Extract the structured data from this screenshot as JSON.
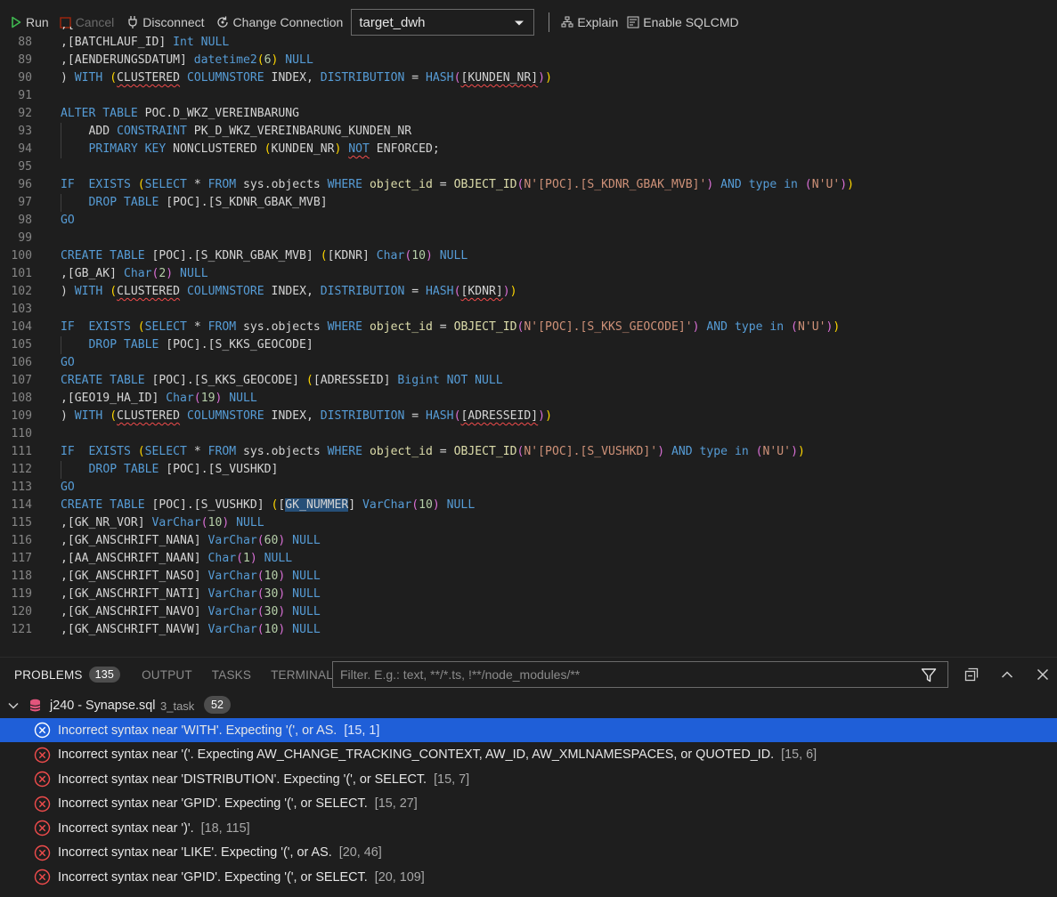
{
  "toolbar": {
    "run": "Run",
    "cancel": "Cancel",
    "disconnect": "Disconnect",
    "change_connection": "Change Connection",
    "connection": "target_dwh",
    "explain": "Explain",
    "sqlcmd": "Enable SQLCMD"
  },
  "editor": {
    "lines": [
      {
        "n": "88",
        "t": [
          [
            ",[BATCHLAUF_ID] ",
            "id"
          ],
          [
            "Int",
            "kw"
          ],
          [
            " NULL",
            "kw"
          ]
        ]
      },
      {
        "n": "89",
        "t": [
          [
            ",[AENDERUNGSDATUM] ",
            "id"
          ],
          [
            "datetime2",
            "kw"
          ],
          [
            "(",
            "br1"
          ],
          [
            "6",
            "num"
          ],
          [
            ")",
            "br1"
          ],
          [
            " NULL",
            "kw"
          ]
        ]
      },
      {
        "n": "90",
        "t": [
          [
            ") ",
            "id"
          ],
          [
            "WITH",
            "kw"
          ],
          [
            " (",
            "br1"
          ],
          [
            "CLUSTERED",
            "sq"
          ],
          [
            " ",
            "id"
          ],
          [
            "COLUMNSTORE",
            "kw"
          ],
          [
            " INDEX, ",
            "id"
          ],
          [
            "DISTRIBUTION",
            "kw"
          ],
          [
            " = ",
            "id"
          ],
          [
            "HASH",
            "kw"
          ],
          [
            "(",
            "br2"
          ],
          [
            "[KUNDEN_NR]",
            "sq"
          ],
          [
            ")",
            "br2"
          ],
          [
            ")",
            "br1"
          ]
        ]
      },
      {
        "n": "91",
        "t": []
      },
      {
        "n": "92",
        "t": [
          [
            "ALTER TABLE",
            "kw"
          ],
          [
            " POC.D_WKZ_VEREINBARUNG",
            "id"
          ]
        ]
      },
      {
        "n": "93",
        "t": [
          [
            "    ADD ",
            "id"
          ],
          [
            "CONSTRAINT",
            "kw"
          ],
          [
            " PK_D_WKZ_VEREINBARUNG_KUNDEN_NR",
            "id"
          ]
        ]
      },
      {
        "n": "94",
        "t": [
          [
            "    ",
            "id"
          ],
          [
            "PRIMARY KEY",
            "kw"
          ],
          [
            " NONCLUSTERED ",
            "id"
          ],
          [
            "(",
            "br1"
          ],
          [
            "KUNDEN_NR",
            "id"
          ],
          [
            ")",
            "br1"
          ],
          [
            " ",
            "id"
          ],
          [
            "NOT",
            "sqkw"
          ],
          [
            " ENFORCED;",
            "id"
          ]
        ]
      },
      {
        "n": "95",
        "t": []
      },
      {
        "n": "96",
        "t": [
          [
            "IF  ",
            "kw"
          ],
          [
            "EXISTS",
            "kw"
          ],
          [
            " (",
            "br1"
          ],
          [
            "SELECT",
            "kw"
          ],
          [
            " * ",
            "id"
          ],
          [
            "FROM",
            "kw"
          ],
          [
            " sys.objects ",
            "id"
          ],
          [
            "WHERE",
            "kw"
          ],
          [
            " object_id ",
            "fn"
          ],
          [
            "= ",
            "id"
          ],
          [
            "OBJECT_ID",
            "fn"
          ],
          [
            "(",
            "br2"
          ],
          [
            "N'[POC].[S_KDNR_GBAK_MVB]'",
            "str"
          ],
          [
            ")",
            "br2"
          ],
          [
            " ",
            "id"
          ],
          [
            "AND",
            "kw"
          ],
          [
            " ",
            "id"
          ],
          [
            "type",
            "kw"
          ],
          [
            " ",
            "id"
          ],
          [
            "in",
            "kw"
          ],
          [
            " (",
            "br2"
          ],
          [
            "N'U'",
            "str"
          ],
          [
            ")",
            "br2"
          ],
          [
            ")",
            "br1"
          ]
        ]
      },
      {
        "n": "97",
        "t": [
          [
            "    ",
            "id"
          ],
          [
            "DROP TABLE",
            "kw"
          ],
          [
            " [POC].[S_KDNR_GBAK_MVB]",
            "id"
          ]
        ]
      },
      {
        "n": "98",
        "t": [
          [
            "GO",
            "kw"
          ]
        ]
      },
      {
        "n": "99",
        "t": []
      },
      {
        "n": "100",
        "t": [
          [
            "CREATE TABLE",
            "kw"
          ],
          [
            " [POC].[S_KDNR_GBAK_MVB] ",
            "id"
          ],
          [
            "(",
            "br1"
          ],
          [
            "[KDNR] ",
            "id"
          ],
          [
            "Char",
            "kw"
          ],
          [
            "(",
            "br2"
          ],
          [
            "10",
            "num"
          ],
          [
            ")",
            "br2"
          ],
          [
            " NULL",
            "kw"
          ]
        ]
      },
      {
        "n": "101",
        "t": [
          [
            ",[GB_AK] ",
            "id"
          ],
          [
            "Char",
            "kw"
          ],
          [
            "(",
            "br2"
          ],
          [
            "2",
            "num"
          ],
          [
            ")",
            "br2"
          ],
          [
            " NULL",
            "kw"
          ]
        ]
      },
      {
        "n": "102",
        "t": [
          [
            ") ",
            "id"
          ],
          [
            "WITH",
            "kw"
          ],
          [
            " (",
            "br1"
          ],
          [
            "CLUSTERED",
            "sq"
          ],
          [
            " ",
            "id"
          ],
          [
            "COLUMNSTORE",
            "kw"
          ],
          [
            " INDEX, ",
            "id"
          ],
          [
            "DISTRIBUTION",
            "kw"
          ],
          [
            " = ",
            "id"
          ],
          [
            "HASH",
            "kw"
          ],
          [
            "(",
            "br2"
          ],
          [
            "[KDNR]",
            "sq"
          ],
          [
            ")",
            "br2"
          ],
          [
            ")",
            "br1"
          ]
        ]
      },
      {
        "n": "103",
        "t": []
      },
      {
        "n": "104",
        "t": [
          [
            "IF  ",
            "kw"
          ],
          [
            "EXISTS",
            "kw"
          ],
          [
            " (",
            "br1"
          ],
          [
            "SELECT",
            "kw"
          ],
          [
            " * ",
            "id"
          ],
          [
            "FROM",
            "kw"
          ],
          [
            " sys.objects ",
            "id"
          ],
          [
            "WHERE",
            "kw"
          ],
          [
            " object_id ",
            "fn"
          ],
          [
            "= ",
            "id"
          ],
          [
            "OBJECT_ID",
            "fn"
          ],
          [
            "(",
            "br2"
          ],
          [
            "N'[POC].[S_KKS_GEOCODE]'",
            "str"
          ],
          [
            ")",
            "br2"
          ],
          [
            " ",
            "id"
          ],
          [
            "AND",
            "kw"
          ],
          [
            " ",
            "id"
          ],
          [
            "type",
            "kw"
          ],
          [
            " ",
            "id"
          ],
          [
            "in",
            "kw"
          ],
          [
            " (",
            "br2"
          ],
          [
            "N'U'",
            "str"
          ],
          [
            ")",
            "br2"
          ],
          [
            ")",
            "br1"
          ]
        ]
      },
      {
        "n": "105",
        "t": [
          [
            "    ",
            "id"
          ],
          [
            "DROP TABLE",
            "kw"
          ],
          [
            " [POC].[S_KKS_GEOCODE]",
            "id"
          ]
        ]
      },
      {
        "n": "106",
        "t": [
          [
            "GO",
            "kw"
          ]
        ]
      },
      {
        "n": "107",
        "t": [
          [
            "CREATE TABLE",
            "kw"
          ],
          [
            " [POC].[S_KKS_GEOCODE] ",
            "id"
          ],
          [
            "(",
            "br1"
          ],
          [
            "[ADRESSEID] ",
            "id"
          ],
          [
            "Bigint",
            "kw"
          ],
          [
            " NOT NULL",
            "kw"
          ]
        ]
      },
      {
        "n": "108",
        "t": [
          [
            ",[GEO19_HA_ID] ",
            "id"
          ],
          [
            "Char",
            "kw"
          ],
          [
            "(",
            "br2"
          ],
          [
            "19",
            "num"
          ],
          [
            ")",
            "br2"
          ],
          [
            " NULL",
            "kw"
          ]
        ]
      },
      {
        "n": "109",
        "t": [
          [
            ") ",
            "id"
          ],
          [
            "WITH",
            "kw"
          ],
          [
            " (",
            "br1"
          ],
          [
            "CLUSTERED",
            "sq"
          ],
          [
            " ",
            "id"
          ],
          [
            "COLUMNSTORE",
            "kw"
          ],
          [
            " INDEX, ",
            "id"
          ],
          [
            "DISTRIBUTION",
            "kw"
          ],
          [
            " = ",
            "id"
          ],
          [
            "HASH",
            "kw"
          ],
          [
            "(",
            "br2"
          ],
          [
            "[ADRESSEID]",
            "sq"
          ],
          [
            ")",
            "br2"
          ],
          [
            ")",
            "br1"
          ]
        ]
      },
      {
        "n": "110",
        "t": []
      },
      {
        "n": "111",
        "t": [
          [
            "IF  ",
            "kw"
          ],
          [
            "EXISTS",
            "kw"
          ],
          [
            " (",
            "br1"
          ],
          [
            "SELECT",
            "kw"
          ],
          [
            " * ",
            "id"
          ],
          [
            "FROM",
            "kw"
          ],
          [
            " sys.objects ",
            "id"
          ],
          [
            "WHERE",
            "kw"
          ],
          [
            " object_id ",
            "fn"
          ],
          [
            "= ",
            "id"
          ],
          [
            "OBJECT_ID",
            "fn"
          ],
          [
            "(",
            "br2"
          ],
          [
            "N'[POC].[S_VUSHKD]'",
            "str"
          ],
          [
            ")",
            "br2"
          ],
          [
            " ",
            "id"
          ],
          [
            "AND",
            "kw"
          ],
          [
            " ",
            "id"
          ],
          [
            "type",
            "kw"
          ],
          [
            " ",
            "id"
          ],
          [
            "in",
            "kw"
          ],
          [
            " (",
            "br2"
          ],
          [
            "N'U'",
            "str"
          ],
          [
            ")",
            "br2"
          ],
          [
            ")",
            "br1"
          ]
        ]
      },
      {
        "n": "112",
        "t": [
          [
            "    ",
            "id"
          ],
          [
            "DROP TABLE",
            "kw"
          ],
          [
            " [POC].[S_VUSHKD]",
            "id"
          ]
        ]
      },
      {
        "n": "113",
        "t": [
          [
            "GO",
            "kw"
          ]
        ]
      },
      {
        "n": "114",
        "t": [
          [
            "CREATE TABLE",
            "kw"
          ],
          [
            " [POC].[S_VUSHKD] ",
            "id"
          ],
          [
            "(",
            "br1"
          ],
          [
            "[",
            "id"
          ],
          [
            "GK_NUMMER",
            "hl"
          ],
          [
            "] ",
            "id"
          ],
          [
            "VarChar",
            "kw"
          ],
          [
            "(",
            "br2"
          ],
          [
            "10",
            "num"
          ],
          [
            ")",
            "br2"
          ],
          [
            " NULL",
            "kw"
          ]
        ]
      },
      {
        "n": "115",
        "t": [
          [
            ",[GK_NR_VOR] ",
            "id"
          ],
          [
            "VarChar",
            "kw"
          ],
          [
            "(",
            "br2"
          ],
          [
            "10",
            "num"
          ],
          [
            ")",
            "br2"
          ],
          [
            " NULL",
            "kw"
          ]
        ]
      },
      {
        "n": "116",
        "t": [
          [
            ",[GK_ANSCHRIFT_NANA] ",
            "id"
          ],
          [
            "VarChar",
            "kw"
          ],
          [
            "(",
            "br2"
          ],
          [
            "60",
            "num"
          ],
          [
            ")",
            "br2"
          ],
          [
            " NULL",
            "kw"
          ]
        ]
      },
      {
        "n": "117",
        "t": [
          [
            ",[AA_ANSCHRIFT_NAAN] ",
            "id"
          ],
          [
            "Char",
            "kw"
          ],
          [
            "(",
            "br2"
          ],
          [
            "1",
            "num"
          ],
          [
            ")",
            "br2"
          ],
          [
            " NULL",
            "kw"
          ]
        ]
      },
      {
        "n": "118",
        "t": [
          [
            ",[GK_ANSCHRIFT_NASO] ",
            "id"
          ],
          [
            "VarChar",
            "kw"
          ],
          [
            "(",
            "br2"
          ],
          [
            "10",
            "num"
          ],
          [
            ")",
            "br2"
          ],
          [
            " NULL",
            "kw"
          ]
        ]
      },
      {
        "n": "119",
        "t": [
          [
            ",[GK_ANSCHRIFT_NATI] ",
            "id"
          ],
          [
            "VarChar",
            "kw"
          ],
          [
            "(",
            "br2"
          ],
          [
            "30",
            "num"
          ],
          [
            ")",
            "br2"
          ],
          [
            " NULL",
            "kw"
          ]
        ]
      },
      {
        "n": "120",
        "t": [
          [
            ",[GK_ANSCHRIFT_NAVO] ",
            "id"
          ],
          [
            "VarChar",
            "kw"
          ],
          [
            "(",
            "br2"
          ],
          [
            "30",
            "num"
          ],
          [
            ")",
            "br2"
          ],
          [
            " NULL",
            "kw"
          ]
        ]
      },
      {
        "n": "121",
        "t": [
          [
            ",[GK_ANSCHRIFT_NAVW] ",
            "id"
          ],
          [
            "VarChar",
            "kw"
          ],
          [
            "(",
            "br2"
          ],
          [
            "10",
            "num"
          ],
          [
            ")",
            "br2"
          ],
          [
            " NULL",
            "kw"
          ]
        ]
      }
    ]
  },
  "panel": {
    "tabs": {
      "problems": "PROBLEMS",
      "problems_count": "135",
      "output": "OUTPUT",
      "tasks": "TASKS",
      "terminal": "TERMINAL"
    },
    "filter_placeholder": "Filter. E.g.: text, **/*.ts, !**/node_modules/**",
    "group": {
      "name": "j240 - Synapse.sql",
      "desc": "3_task",
      "count": "52"
    },
    "problems": [
      {
        "msg": "Incorrect syntax near 'WITH'. Expecting '(', or AS.",
        "loc": "[15, 1]"
      },
      {
        "msg": "Incorrect syntax near '('. Expecting AW_CHANGE_TRACKING_CONTEXT, AW_ID, AW_XMLNAMESPACES, or QUOTED_ID.",
        "loc": "[15, 6]"
      },
      {
        "msg": "Incorrect syntax near 'DISTRIBUTION'. Expecting '(', or SELECT.",
        "loc": "[15, 7]"
      },
      {
        "msg": "Incorrect syntax near 'GPID'. Expecting '(', or SELECT.",
        "loc": "[15, 27]"
      },
      {
        "msg": "Incorrect syntax near ')'.",
        "loc": "[18, 115]"
      },
      {
        "msg": "Incorrect syntax near 'LIKE'. Expecting '(', or AS.",
        "loc": "[20, 46]"
      },
      {
        "msg": "Incorrect syntax near 'GPID'. Expecting '(', or SELECT.",
        "loc": "[20, 109]"
      }
    ]
  },
  "colors": {
    "background": "#1e1e1e",
    "selection": "#1f5fd8",
    "error": "#f14c4c",
    "keyword": "#569cd6",
    "string": "#ce9178",
    "number": "#b5cea8",
    "function": "#dcdcaa"
  },
  "icons": {
    "run": "play-icon",
    "cancel": "stop-icon",
    "disconnect": "plug-icon",
    "change_connection": "refresh-icon",
    "explain": "explain-icon",
    "sqlcmd": "sqlcmd-icon",
    "filter": "funnel-icon",
    "collapse_all": "collapse-all-icon",
    "maximize": "chevron-up-icon",
    "close": "close-icon",
    "error": "error-circle-icon"
  }
}
